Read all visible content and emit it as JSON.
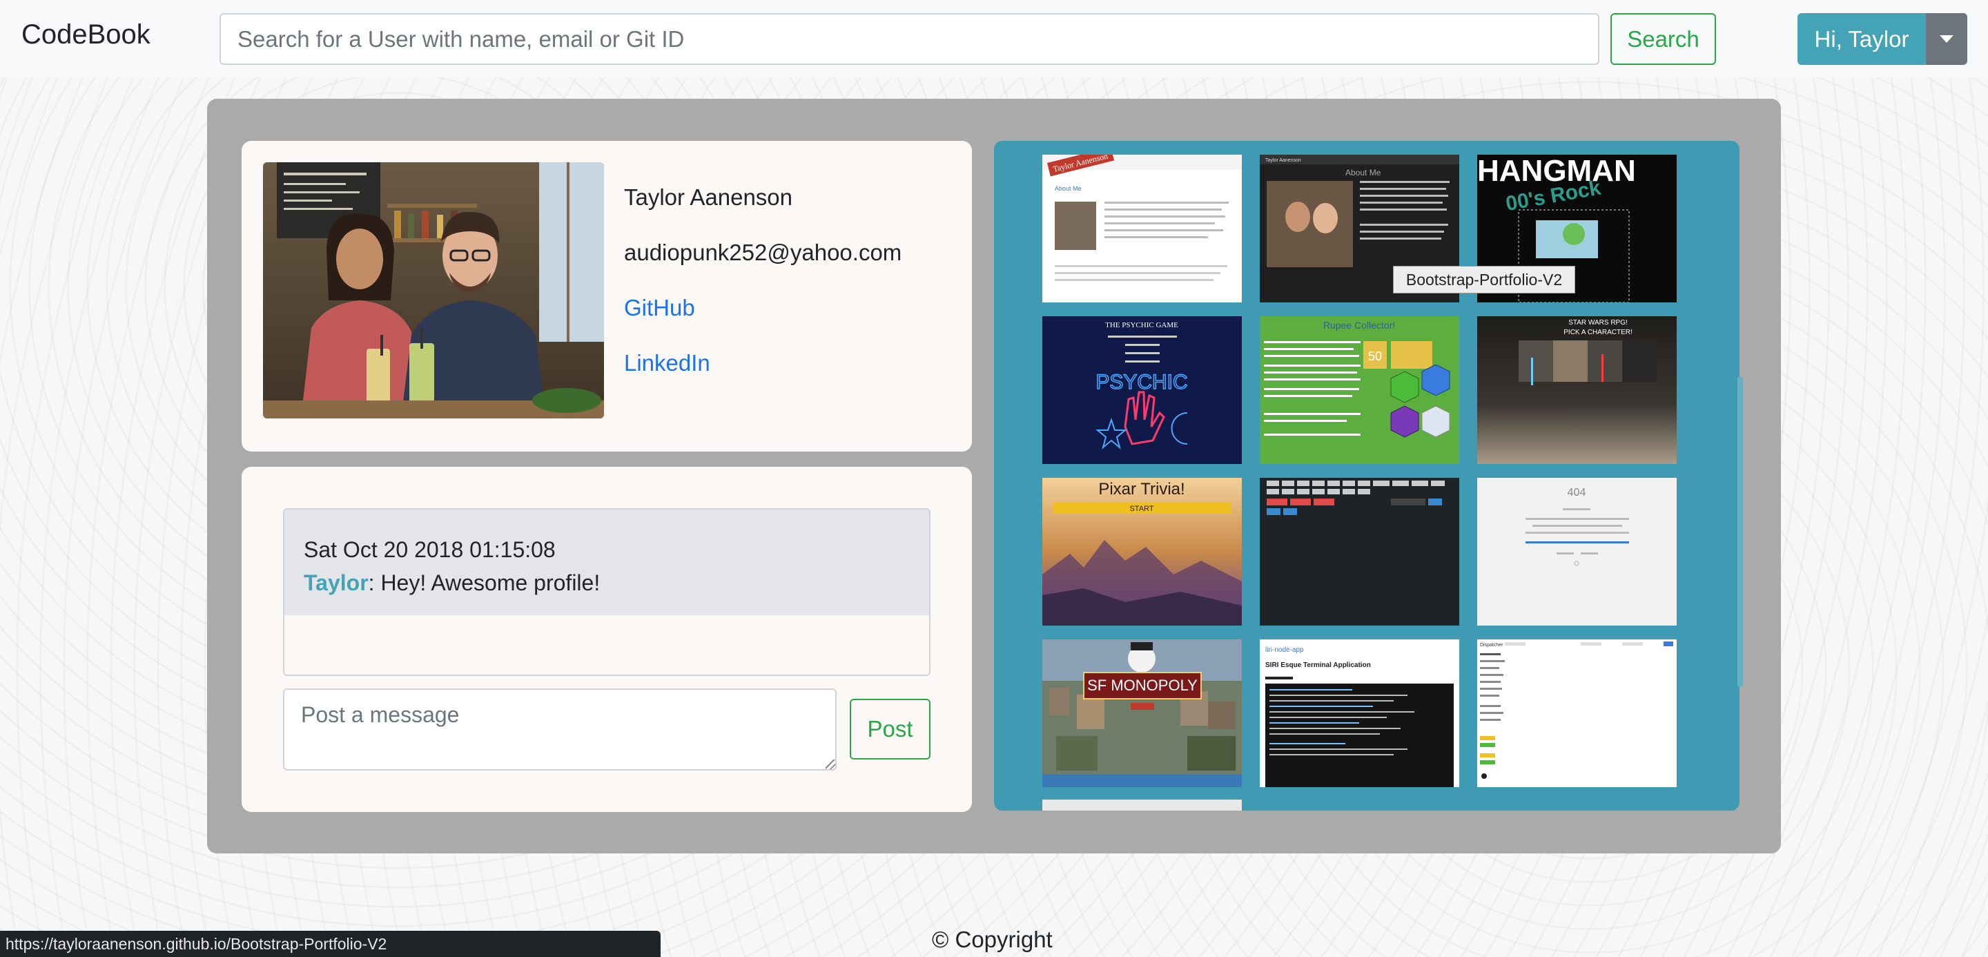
{
  "navbar": {
    "brand": "CodeBook",
    "search_placeholder": "Search for a User with name, email or Git ID",
    "search_button": "Search",
    "user_greeting": "Hi, Taylor"
  },
  "profile": {
    "name": "Taylor Aanenson",
    "email": "audiopunk252@yahoo.com",
    "github_label": "GitHub",
    "linkedin_label": "LinkedIn"
  },
  "messages": {
    "items": [
      {
        "date": "Sat Oct 20 2018 01:15:08",
        "author": "Taylor",
        "text": ": Hey! Awesome profile!"
      }
    ],
    "post_placeholder": "Post a message",
    "post_button": "Post"
  },
  "gallery": {
    "tooltip": "Bootstrap-Portfolio-V2",
    "thumbnails": [
      {
        "caption": "Taylor Aanenson",
        "subtitle": "About Me"
      },
      {
        "caption": "Taylor Aanenson",
        "subtitle": "About Me"
      },
      {
        "caption": "HANGMAN",
        "subtitle": "00's Rock"
      },
      {
        "caption": "THE PSYCHIC GAME",
        "subtitle": "PSYCHIC"
      },
      {
        "caption": "Rupee Collector!",
        "subtitle": "50"
      },
      {
        "caption": "STAR WARS RPG!",
        "subtitle": "PICK A CHARACTER!"
      },
      {
        "caption": "Pixar Trivia!",
        "subtitle": "START"
      },
      {
        "caption": "",
        "subtitle": ""
      },
      {
        "caption": "404",
        "subtitle": ""
      },
      {
        "caption": "SF MONOPOLY",
        "subtitle": ""
      },
      {
        "caption": "liri-node-app",
        "subtitle": "SIRI Esque Terminal Application"
      },
      {
        "caption": "Dispatcher",
        "subtitle": ""
      }
    ]
  },
  "footer": {
    "copyright": "© Copyright",
    "status_url": "https://tayloraanenson.github.io/Bootstrap-Portfolio-V2"
  }
}
